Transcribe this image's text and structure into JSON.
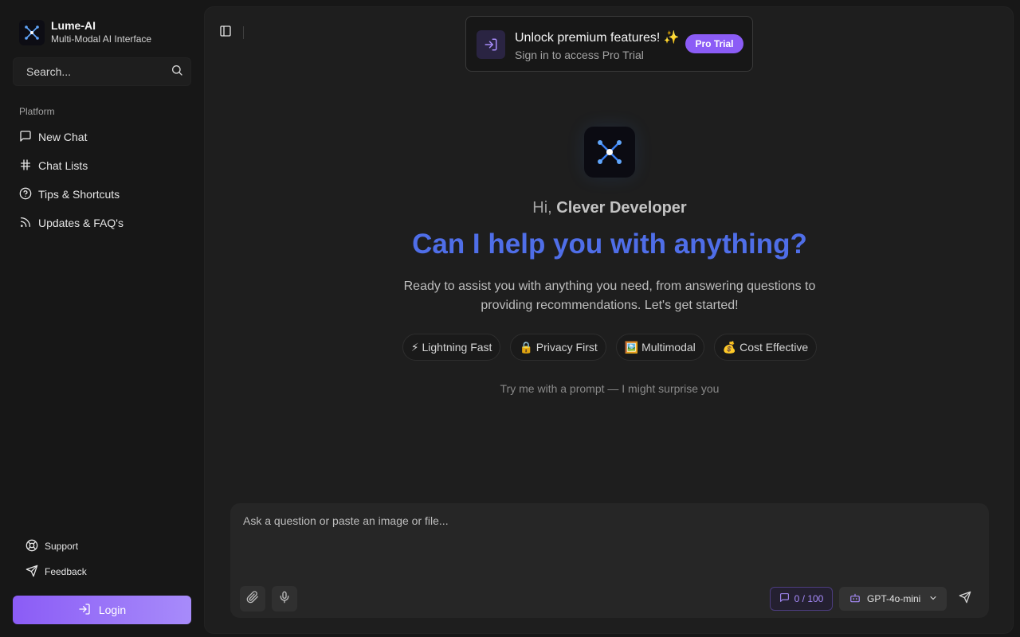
{
  "brand": {
    "name": "Lume-AI",
    "subtitle": "Multi-Modal AI Interface",
    "logo_icon": "network-x-icon"
  },
  "search": {
    "placeholder": "Search...",
    "icon": "search-icon"
  },
  "sidebar": {
    "section_label": "Platform",
    "items": [
      {
        "label": "New Chat",
        "icon": "message-square-icon"
      },
      {
        "label": "Chat Lists",
        "icon": "hash-icon"
      },
      {
        "label": "Tips & Shortcuts",
        "icon": "help-circle-icon"
      },
      {
        "label": "Updates & FAQ's",
        "icon": "rss-icon"
      }
    ],
    "footer": [
      {
        "label": "Support",
        "icon": "life-buoy-icon"
      },
      {
        "label": "Feedback",
        "icon": "send-icon"
      }
    ],
    "login_label": "Login"
  },
  "promo": {
    "title": "Unlock premium features! ✨",
    "subtitle": "Sign in to access Pro Trial",
    "button": "Pro Trial"
  },
  "hero": {
    "greeting_prefix": "Hi, ",
    "user_name": "Clever Developer",
    "headline": "Can I help you with anything?",
    "description": "Ready to assist you with anything you need, from answering questions to providing recommendations. Let's get started!",
    "badges": [
      "⚡ Lightning Fast",
      "🔒 Privacy First",
      "🖼️ Multimodal",
      "💰 Cost Effective"
    ],
    "prompt_hint": "Try me with a prompt — I might surprise you"
  },
  "composer": {
    "placeholder": "Ask a question or paste an image or file...",
    "counter": "0 / 100",
    "model": "GPT-4o-mini"
  },
  "colors": {
    "accent": "#8b5cf6",
    "headline": "#4f6ee8",
    "background": "#171717",
    "panel": "#1e1e1e"
  }
}
